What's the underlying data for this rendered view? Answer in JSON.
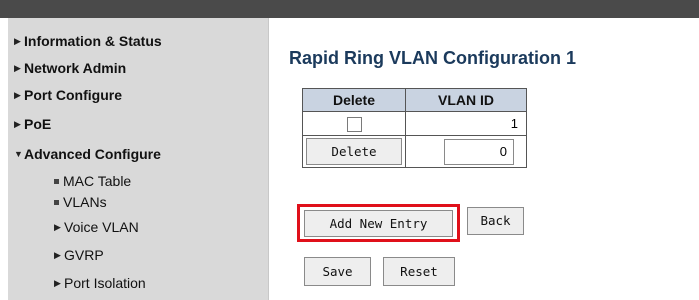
{
  "sidebar": {
    "items": [
      {
        "label": "Information & Status",
        "icon": "triangle-right-icon"
      },
      {
        "label": "Network Admin",
        "icon": "triangle-right-icon"
      },
      {
        "label": "Port Configure",
        "icon": "triangle-right-icon"
      },
      {
        "label": "PoE",
        "icon": "triangle-right-icon"
      },
      {
        "label": "Advanced Configure",
        "icon": "triangle-down-icon"
      }
    ],
    "subitems": [
      {
        "label": "MAC Table",
        "icon": "bullet-icon"
      },
      {
        "label": "VLANs",
        "icon": "bullet-icon"
      },
      {
        "label": "Voice VLAN",
        "icon": "triangle-right-icon"
      },
      {
        "label": "GVRP",
        "icon": "triangle-right-icon"
      },
      {
        "label": "Port Isolation",
        "icon": "triangle-right-icon"
      }
    ]
  },
  "page": {
    "title": "Rapid Ring VLAN Configuration 1"
  },
  "table": {
    "headers": [
      "Delete",
      "VLAN ID"
    ],
    "rows": [
      {
        "delete_checked": false,
        "vlan_id": "1"
      }
    ],
    "new_row": {
      "delete_button_label": "Delete",
      "vlan_id_value": "0"
    }
  },
  "buttons": {
    "add_new_entry": "Add New Entry",
    "back": "Back",
    "save": "Save",
    "reset": "Reset"
  },
  "colors": {
    "header_bar": "#4a4a4a",
    "sidebar_bg": "#d9d9d9",
    "title": "#1b3a5c",
    "table_header_bg": "#c9d3e1",
    "highlight": "#e0101a"
  }
}
